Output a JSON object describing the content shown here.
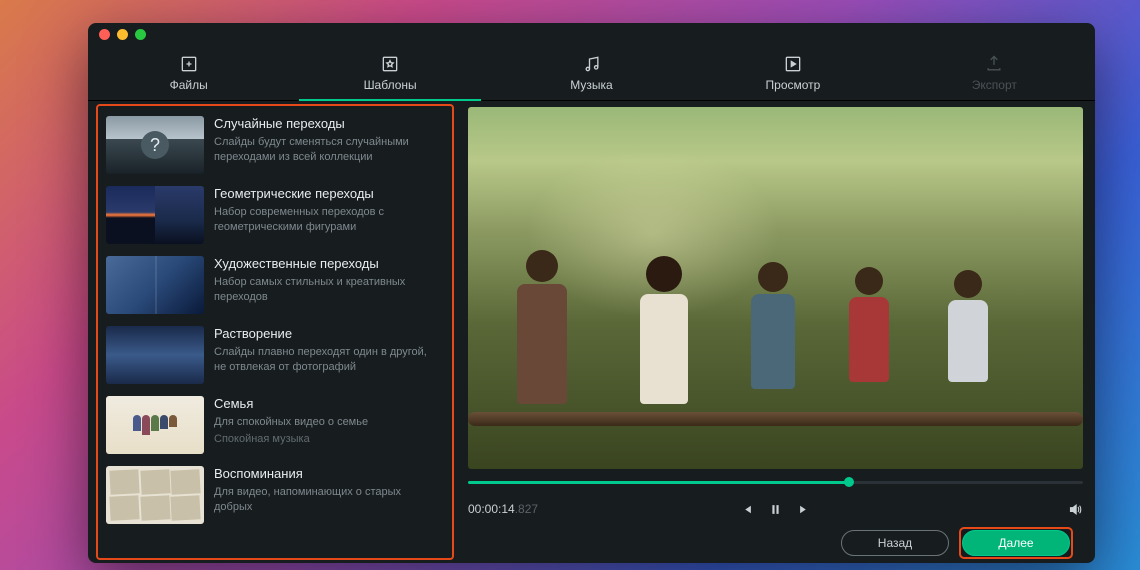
{
  "tabs": {
    "files": {
      "label": "Файлы"
    },
    "templates": {
      "label": "Шаблоны"
    },
    "music": {
      "label": "Музыка"
    },
    "preview": {
      "label": "Просмотр"
    },
    "export": {
      "label": "Экспорт"
    }
  },
  "templates": [
    {
      "title": "Случайные переходы",
      "desc": "Слайды будут сменяться случайными переходами из всей коллекции",
      "sub": ""
    },
    {
      "title": "Геометрические переходы",
      "desc": "Набор современных переходов с геометрическими фигурами",
      "sub": ""
    },
    {
      "title": "Художественные переходы",
      "desc": "Набор самых стильных и креативных переходов",
      "sub": ""
    },
    {
      "title": "Растворение",
      "desc": "Слайды плавно переходят один в другой, не отвлекая от фотографий",
      "sub": ""
    },
    {
      "title": "Семья",
      "desc": "Для спокойных видео о семье",
      "sub": "Спокойная музыка"
    },
    {
      "title": "Воспоминания",
      "desc": "Для видео, напоминающих о старых добрых",
      "sub": ""
    }
  ],
  "player": {
    "time_main": "00:00:14",
    "time_ms": ".827"
  },
  "footer": {
    "back": "Назад",
    "next": "Далее"
  }
}
